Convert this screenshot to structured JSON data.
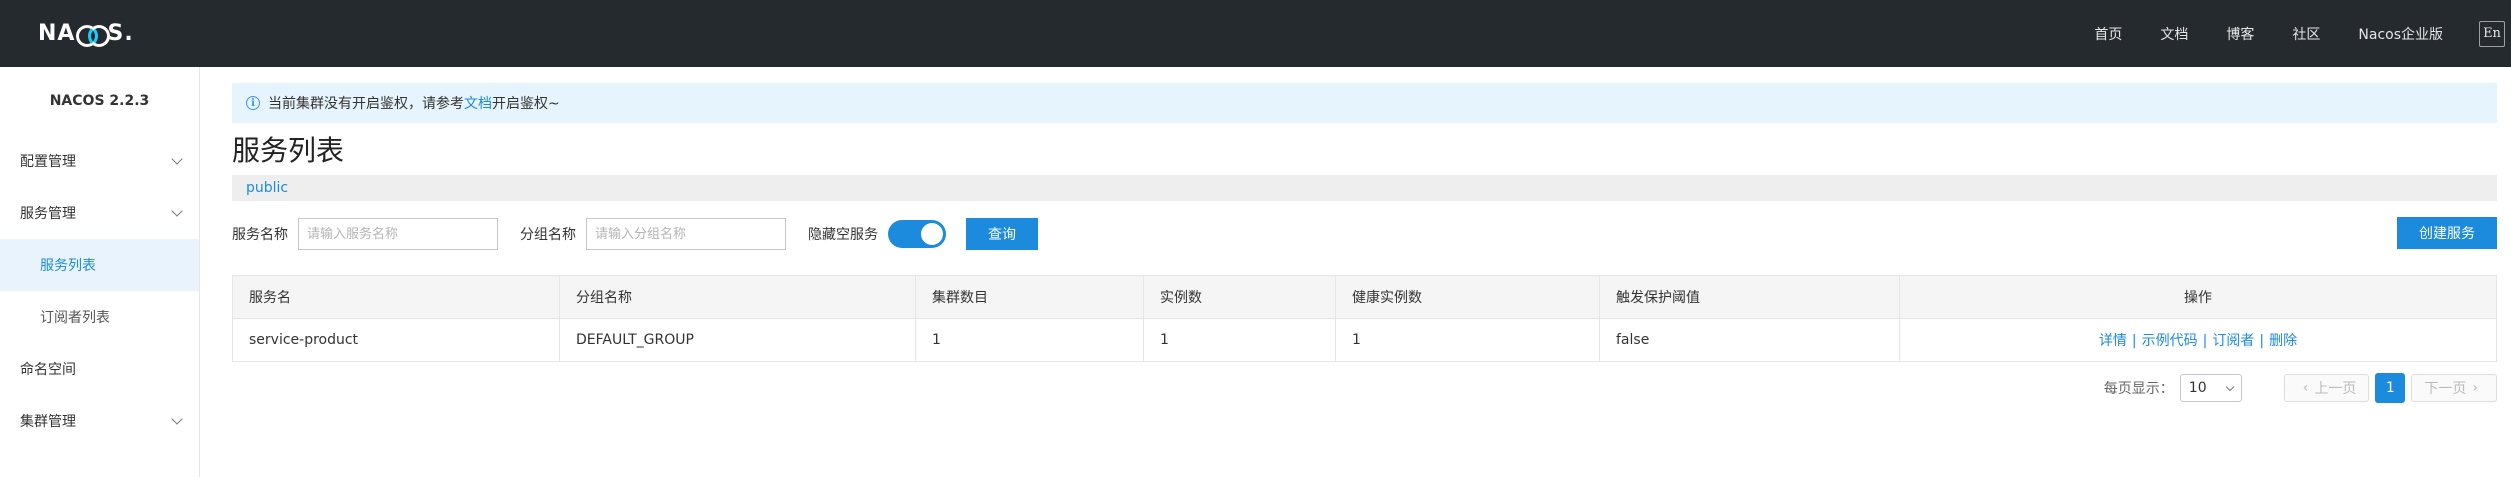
{
  "header": {
    "logo": "NACOS.",
    "nav": [
      "首页",
      "文档",
      "博客",
      "社区",
      "Nacos企业版"
    ],
    "lang_button": "En"
  },
  "sidebar": {
    "version": "NACOS 2.2.3",
    "items": [
      {
        "label": "配置管理"
      },
      {
        "label": "服务管理"
      },
      {
        "label": "服务列表"
      },
      {
        "label": "订阅者列表"
      },
      {
        "label": "命名空间"
      },
      {
        "label": "集群管理"
      }
    ]
  },
  "alert": {
    "prefix": "当前集群没有开启鉴权，请参考",
    "link": "文档",
    "suffix": "开启鉴权~"
  },
  "page": {
    "title": "服务列表",
    "namespace": "public"
  },
  "filters": {
    "service_name_label": "服务名称",
    "service_name_placeholder": "请输入服务名称",
    "group_name_label": "分组名称",
    "group_name_placeholder": "请输入分组名称",
    "hide_empty_label": "隐藏空服务",
    "search_button": "查询",
    "create_button": "创建服务"
  },
  "table": {
    "columns": [
      "服务名",
      "分组名称",
      "集群数目",
      "实例数",
      "健康实例数",
      "触发保护阈值",
      "操作"
    ],
    "rows": [
      {
        "service": "service-product",
        "group": "DEFAULT_GROUP",
        "clusters": "1",
        "instances": "1",
        "healthy": "1",
        "threshold": "false",
        "ops": [
          "详情",
          "示例代码",
          "订阅者",
          "删除"
        ]
      }
    ]
  },
  "pagination": {
    "per_page_label": "每页显示：",
    "per_page_value": "10",
    "prev": "上一页",
    "current": "1",
    "next": "下一页"
  },
  "colors": {
    "topbar": "#252a2f",
    "accent": "#1c8bdd",
    "alert_bg": "#e6f4fe"
  }
}
